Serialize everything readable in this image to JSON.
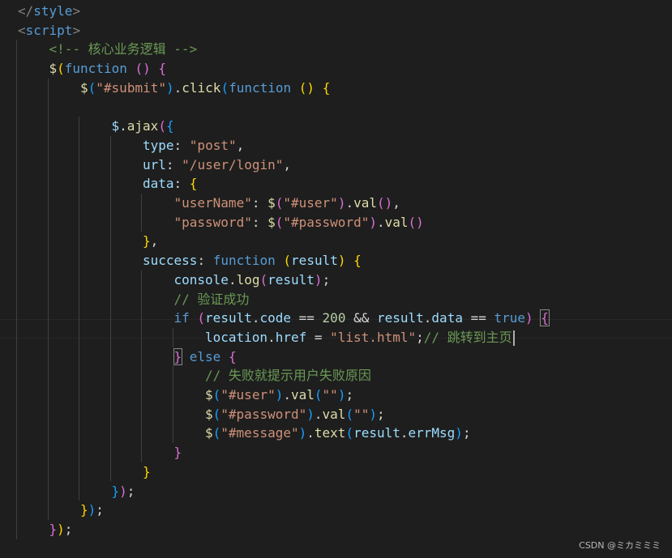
{
  "editor": {
    "watermark": "CSDN @ミカミミミ",
    "caret_line": 17,
    "lines": [
      {
        "indent": 0,
        "tokens": [
          {
            "t": "</",
            "c": "tag"
          },
          {
            "t": "style",
            "c": "tagname"
          },
          {
            "t": ">",
            "c": "tag"
          }
        ]
      },
      {
        "indent": 0,
        "tokens": [
          {
            "t": "<",
            "c": "tag"
          },
          {
            "t": "script",
            "c": "tagname"
          },
          {
            "t": ">",
            "c": "tag"
          }
        ]
      },
      {
        "indent": 1,
        "tokens": [
          {
            "t": "<!-- 核心业务逻辑 -->",
            "c": "comment"
          }
        ]
      },
      {
        "indent": 1,
        "tokens": [
          {
            "t": "$",
            "c": "fn"
          },
          {
            "t": "(",
            "c": "b1"
          },
          {
            "t": "function",
            "c": "kw"
          },
          {
            "t": " ",
            "c": "punc"
          },
          {
            "t": "()",
            "c": "b2"
          },
          {
            "t": " ",
            "c": "punc"
          },
          {
            "t": "{",
            "c": "b2"
          }
        ]
      },
      {
        "indent": 2,
        "tokens": [
          {
            "t": "$",
            "c": "fn"
          },
          {
            "t": "(",
            "c": "b3"
          },
          {
            "t": "\"#submit\"",
            "c": "str"
          },
          {
            "t": ")",
            "c": "b3"
          },
          {
            "t": ".",
            "c": "punc"
          },
          {
            "t": "click",
            "c": "fn"
          },
          {
            "t": "(",
            "c": "b3"
          },
          {
            "t": "function",
            "c": "kw"
          },
          {
            "t": " ",
            "c": "punc"
          },
          {
            "t": "()",
            "c": "b1"
          },
          {
            "t": " ",
            "c": "punc"
          },
          {
            "t": "{",
            "c": "b1"
          }
        ]
      },
      {
        "indent": 0,
        "tokens": []
      },
      {
        "indent": 3,
        "tokens": [
          {
            "t": "$",
            "c": "ident"
          },
          {
            "t": ".",
            "c": "punc"
          },
          {
            "t": "ajax",
            "c": "fn"
          },
          {
            "t": "(",
            "c": "b2"
          },
          {
            "t": "{",
            "c": "b3"
          }
        ]
      },
      {
        "indent": 4,
        "tokens": [
          {
            "t": "type",
            "c": "ident"
          },
          {
            "t": ": ",
            "c": "punc"
          },
          {
            "t": "\"post\"",
            "c": "str"
          },
          {
            "t": ",",
            "c": "punc"
          }
        ]
      },
      {
        "indent": 4,
        "tokens": [
          {
            "t": "url",
            "c": "ident"
          },
          {
            "t": ": ",
            "c": "punc"
          },
          {
            "t": "\"/user/login\"",
            "c": "str"
          },
          {
            "t": ",",
            "c": "punc"
          }
        ]
      },
      {
        "indent": 4,
        "tokens": [
          {
            "t": "data",
            "c": "ident"
          },
          {
            "t": ": ",
            "c": "punc"
          },
          {
            "t": "{",
            "c": "b1"
          }
        ]
      },
      {
        "indent": 5,
        "tokens": [
          {
            "t": "\"userName\"",
            "c": "str"
          },
          {
            "t": ": ",
            "c": "punc"
          },
          {
            "t": "$",
            "c": "fn"
          },
          {
            "t": "(",
            "c": "b2"
          },
          {
            "t": "\"#user\"",
            "c": "str"
          },
          {
            "t": ")",
            "c": "b2"
          },
          {
            "t": ".",
            "c": "punc"
          },
          {
            "t": "val",
            "c": "fn"
          },
          {
            "t": "()",
            "c": "b2"
          },
          {
            "t": ",",
            "c": "punc"
          }
        ]
      },
      {
        "indent": 5,
        "tokens": [
          {
            "t": "\"password\"",
            "c": "str"
          },
          {
            "t": ": ",
            "c": "punc"
          },
          {
            "t": "$",
            "c": "fn"
          },
          {
            "t": "(",
            "c": "b2"
          },
          {
            "t": "\"#password\"",
            "c": "str"
          },
          {
            "t": ")",
            "c": "b2"
          },
          {
            "t": ".",
            "c": "punc"
          },
          {
            "t": "val",
            "c": "fn"
          },
          {
            "t": "()",
            "c": "b2"
          }
        ]
      },
      {
        "indent": 4,
        "tokens": [
          {
            "t": "}",
            "c": "b1"
          },
          {
            "t": ",",
            "c": "punc"
          }
        ]
      },
      {
        "indent": 4,
        "tokens": [
          {
            "t": "success",
            "c": "ident"
          },
          {
            "t": ": ",
            "c": "punc"
          },
          {
            "t": "function",
            "c": "kw"
          },
          {
            "t": " ",
            "c": "punc"
          },
          {
            "t": "(",
            "c": "b1"
          },
          {
            "t": "result",
            "c": "ident"
          },
          {
            "t": ")",
            "c": "b1"
          },
          {
            "t": " ",
            "c": "punc"
          },
          {
            "t": "{",
            "c": "b1"
          }
        ]
      },
      {
        "indent": 5,
        "tokens": [
          {
            "t": "console",
            "c": "ident"
          },
          {
            "t": ".",
            "c": "punc"
          },
          {
            "t": "log",
            "c": "fn"
          },
          {
            "t": "(",
            "c": "b2"
          },
          {
            "t": "result",
            "c": "ident"
          },
          {
            "t": ")",
            "c": "b2"
          },
          {
            "t": ";",
            "c": "punc"
          }
        ]
      },
      {
        "indent": 5,
        "tokens": [
          {
            "t": "// 验证成功",
            "c": "comment"
          }
        ]
      },
      {
        "indent": 5,
        "tokens": [
          {
            "t": "if",
            "c": "kw"
          },
          {
            "t": " ",
            "c": "punc"
          },
          {
            "t": "(",
            "c": "b2"
          },
          {
            "t": "result",
            "c": "ident"
          },
          {
            "t": ".",
            "c": "punc"
          },
          {
            "t": "code",
            "c": "ident"
          },
          {
            "t": " == ",
            "c": "punc"
          },
          {
            "t": "200",
            "c": "num"
          },
          {
            "t": " && ",
            "c": "punc"
          },
          {
            "t": "result",
            "c": "ident"
          },
          {
            "t": ".",
            "c": "punc"
          },
          {
            "t": "data",
            "c": "ident"
          },
          {
            "t": " == ",
            "c": "punc"
          },
          {
            "t": "true",
            "c": "kw"
          },
          {
            "t": ")",
            "c": "b2"
          },
          {
            "t": " ",
            "c": "punc"
          },
          {
            "t": "{",
            "c": "b2",
            "m": true
          }
        ]
      },
      {
        "indent": 6,
        "tokens": [
          {
            "t": "location",
            "c": "ident"
          },
          {
            "t": ".",
            "c": "punc"
          },
          {
            "t": "href",
            "c": "ident"
          },
          {
            "t": " = ",
            "c": "punc"
          },
          {
            "t": "\"list.html\"",
            "c": "str"
          },
          {
            "t": ";",
            "c": "punc"
          },
          {
            "t": "// 跳转到主页",
            "c": "comment"
          }
        ]
      },
      {
        "indent": 5,
        "tokens": [
          {
            "t": "}",
            "c": "b2",
            "m": true
          },
          {
            "t": " ",
            "c": "punc"
          },
          {
            "t": "else",
            "c": "kw"
          },
          {
            "t": " ",
            "c": "punc"
          },
          {
            "t": "{",
            "c": "b2"
          }
        ]
      },
      {
        "indent": 6,
        "tokens": [
          {
            "t": "// 失败就提示用户失败原因",
            "c": "comment"
          }
        ]
      },
      {
        "indent": 6,
        "tokens": [
          {
            "t": "$",
            "c": "fn"
          },
          {
            "t": "(",
            "c": "b3"
          },
          {
            "t": "\"#user\"",
            "c": "str"
          },
          {
            "t": ")",
            "c": "b3"
          },
          {
            "t": ".",
            "c": "punc"
          },
          {
            "t": "val",
            "c": "fn"
          },
          {
            "t": "(",
            "c": "b3"
          },
          {
            "t": "\"\"",
            "c": "str"
          },
          {
            "t": ")",
            "c": "b3"
          },
          {
            "t": ";",
            "c": "punc"
          }
        ]
      },
      {
        "indent": 6,
        "tokens": [
          {
            "t": "$",
            "c": "fn"
          },
          {
            "t": "(",
            "c": "b3"
          },
          {
            "t": "\"#password\"",
            "c": "str"
          },
          {
            "t": ")",
            "c": "b3"
          },
          {
            "t": ".",
            "c": "punc"
          },
          {
            "t": "val",
            "c": "fn"
          },
          {
            "t": "(",
            "c": "b3"
          },
          {
            "t": "\"\"",
            "c": "str"
          },
          {
            "t": ")",
            "c": "b3"
          },
          {
            "t": ";",
            "c": "punc"
          }
        ]
      },
      {
        "indent": 6,
        "tokens": [
          {
            "t": "$",
            "c": "fn"
          },
          {
            "t": "(",
            "c": "b3"
          },
          {
            "t": "\"#message\"",
            "c": "str"
          },
          {
            "t": ")",
            "c": "b3"
          },
          {
            "t": ".",
            "c": "punc"
          },
          {
            "t": "text",
            "c": "fn"
          },
          {
            "t": "(",
            "c": "b3"
          },
          {
            "t": "result",
            "c": "ident"
          },
          {
            "t": ".",
            "c": "punc"
          },
          {
            "t": "errMsg",
            "c": "ident"
          },
          {
            "t": ")",
            "c": "b3"
          },
          {
            "t": ";",
            "c": "punc"
          }
        ]
      },
      {
        "indent": 5,
        "tokens": [
          {
            "t": "}",
            "c": "b2"
          }
        ]
      },
      {
        "indent": 4,
        "tokens": [
          {
            "t": "}",
            "c": "b1"
          }
        ]
      },
      {
        "indent": 3,
        "tokens": [
          {
            "t": "}",
            "c": "b3"
          },
          {
            "t": ")",
            "c": "b2"
          },
          {
            "t": ";",
            "c": "punc"
          }
        ]
      },
      {
        "indent": 2,
        "tokens": [
          {
            "t": "}",
            "c": "b1"
          },
          {
            "t": ")",
            "c": "b3"
          },
          {
            "t": ";",
            "c": "punc"
          }
        ]
      },
      {
        "indent": 1,
        "tokens": [
          {
            "t": "}",
            "c": "b2"
          },
          {
            "t": ")",
            "c": "b1"
          },
          {
            "t": ";",
            "c": "punc"
          }
        ]
      }
    ]
  },
  "theme": {
    "background": "#1e1e1e",
    "keyword": "#569cd6",
    "string": "#ce9178",
    "identifier": "#9cdcfe",
    "function": "#dcdcaa",
    "comment": "#6a9955",
    "number": "#b5cea8",
    "bracket_1": "#ffd700",
    "bracket_2": "#da70d6",
    "bracket_3": "#179fff"
  }
}
